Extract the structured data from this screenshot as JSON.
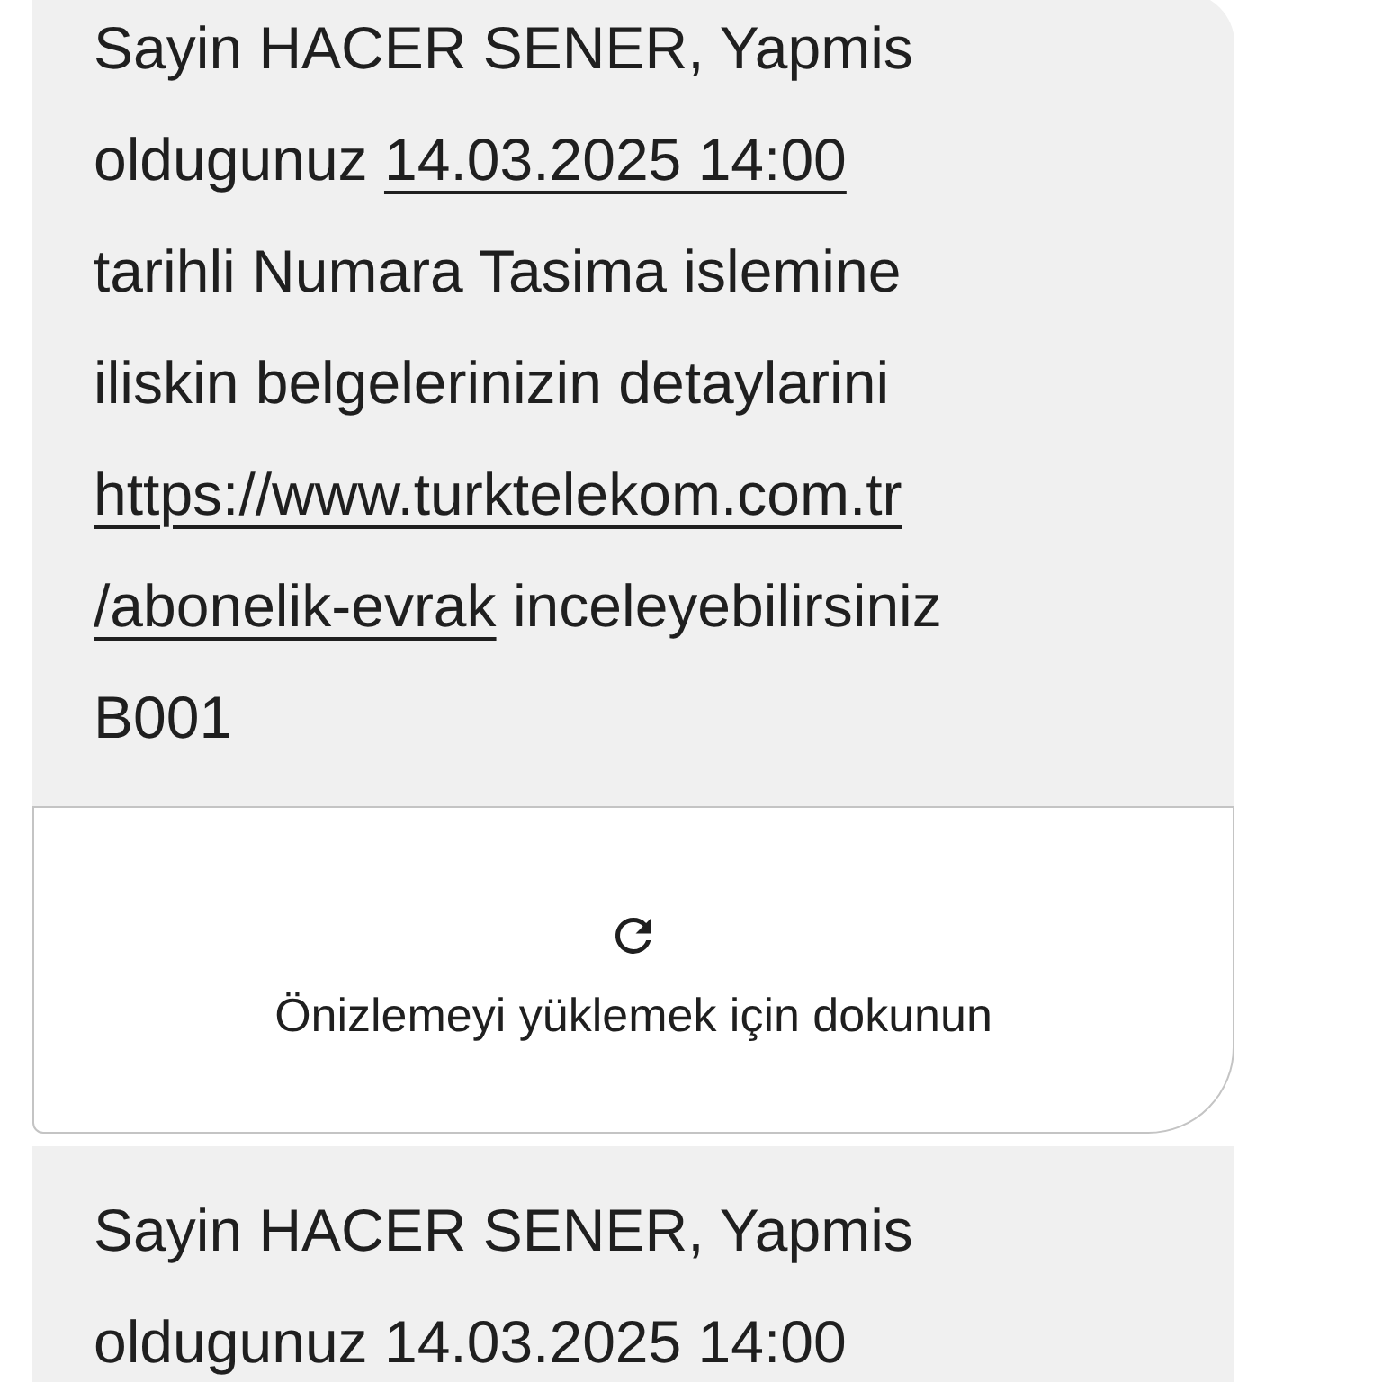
{
  "messages": [
    {
      "lines": [
        [
          {
            "kind": "text",
            "text": "Sayin HACER SENER, Yapmis"
          }
        ],
        [
          {
            "kind": "text",
            "text": "oldugunuz "
          },
          {
            "kind": "link",
            "text": "14.03.2025 14:00"
          }
        ],
        [
          {
            "kind": "text",
            "text": "tarihli Numara Tasima islemine"
          }
        ],
        [
          {
            "kind": "text",
            "text": "iliskin belgelerinizin detaylarini"
          }
        ],
        [
          {
            "kind": "link",
            "text": "https://www.turktelekom.com.tr"
          }
        ],
        [
          {
            "kind": "link",
            "text": "/abonelik-evrak"
          },
          {
            "kind": "text",
            "text": " inceleyebilirsiniz"
          }
        ],
        [
          {
            "kind": "text",
            "text": "B001"
          }
        ]
      ],
      "preview": {
        "label": "Önizlemeyi yüklemek için dokunun"
      }
    },
    {
      "lines": [
        [
          {
            "kind": "text",
            "text": "Sayin HACER SENER, Yapmis"
          }
        ],
        [
          {
            "kind": "text",
            "text": "oldugunuz 14.03.2025 14:00"
          }
        ]
      ]
    }
  ]
}
